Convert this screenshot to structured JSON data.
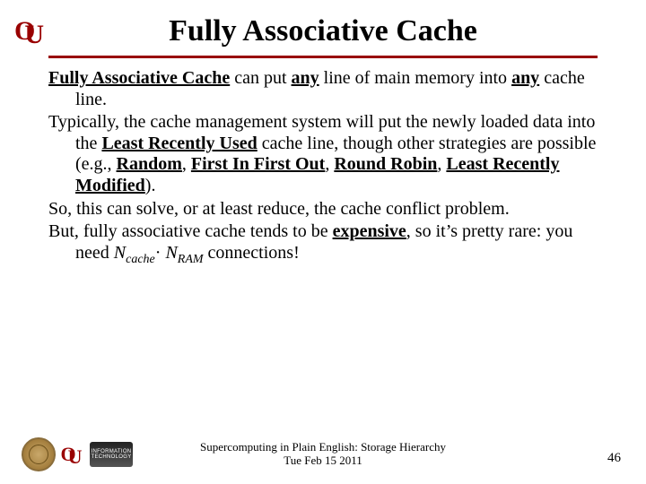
{
  "title": "Fully Associative Cache",
  "body": {
    "p1": {
      "lead": "Fully Associative Cache",
      "t1": " can put ",
      "any1": "any",
      "t2": " line of main memory into ",
      "any2": "any",
      "t3": " cache line."
    },
    "p2": {
      "t1": "Typically, the cache management system will put the newly loaded data into the ",
      "lru": "Least Recently Used",
      "t2": " cache line, though other strategies are possible (e.g., ",
      "random": "Random",
      "c1": ", ",
      "fifo": "First In First Out",
      "c2": ", ",
      "rr": "Round Robin",
      "c3": ", ",
      "lrm": "Least Recently Modified",
      "t3": ")."
    },
    "p3": "So, this can solve, or at least reduce, the cache conflict problem.",
    "p4": {
      "t1": "But, fully associative cache tends to be ",
      "exp": "expensive",
      "t2": ", so it’s pretty rare: you need ",
      "nA": "N",
      "subA": "cache",
      "dot": "· ",
      "nB": "N",
      "subB": "RAM",
      "t3": " connections!"
    }
  },
  "footer": {
    "line1": "Supercomputing in Plain English: Storage Hierarchy",
    "line2": "Tue Feb 15 2011",
    "page": "46",
    "it_label": "INFORMATION\nTECHNOLOGY"
  },
  "logos": {
    "ou": "OU",
    "seal": "university-seal",
    "it": "it-logo"
  }
}
